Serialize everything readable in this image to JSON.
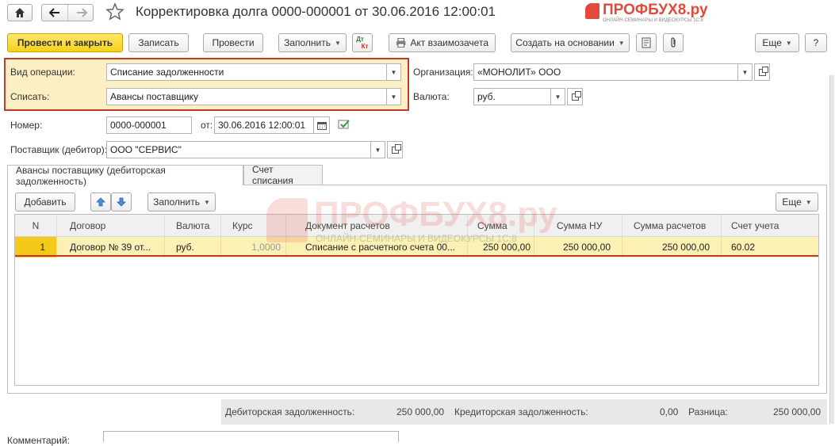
{
  "window": {
    "title": "Корректировка долга 0000-000001 от 30.06.2016 12:00:01",
    "watermark_brand": "ПРОФБУХ8.ру",
    "watermark_sub": "ОНЛАЙН-СЕМИНАРЫ И ВИДЕОКУРСЫ 1С:8"
  },
  "toolbar": {
    "post_close": "Провести и закрыть",
    "save": "Записать",
    "post": "Провести",
    "fill": "Заполнить",
    "dtkt_top": "Дт",
    "dtkt_bottom": "Кт",
    "act": "Акт взаимозачета",
    "create_based": "Создать на основании",
    "more": "Еще",
    "help": "?"
  },
  "form": {
    "operation_label": "Вид операции:",
    "operation_value": "Списание задолженности",
    "writeoff_label": "Списать:",
    "writeoff_value": "Авансы поставщику",
    "org_label": "Организация:",
    "org_value": "«МОНОЛИТ» ООО",
    "currency_label": "Валюта:",
    "currency_value": "руб.",
    "number_label": "Номер:",
    "number_value": "0000-000001",
    "date_label": "от:",
    "date_value": "30.06.2016 12:00:01",
    "supplier_label": "Поставщик (дебитор):",
    "supplier_value": "ООО \"СЕРВИС\""
  },
  "tabs": [
    {
      "label": "Авансы поставщику (дебиторская задолженность)"
    },
    {
      "label": "Счет списания"
    }
  ],
  "table_toolbar": {
    "add": "Добавить",
    "fill": "Заполнить",
    "more": "Еще"
  },
  "table": {
    "headers": [
      "N",
      "Договор",
      "Валюта",
      "Курс",
      "Документ расчетов",
      "Сумма",
      "Сумма НУ",
      "Сумма расчетов",
      "Счет учета"
    ],
    "rows": [
      [
        "1",
        "Договор № 39 от...",
        "руб.",
        "1,0000",
        "Списание с расчетного счета 00...",
        "250 000,00",
        "250 000,00",
        "250 000,00",
        "60.02"
      ]
    ]
  },
  "footer": {
    "debit_label": "Дебиторская задолженность:",
    "debit_value": "250 000,00",
    "credit_label": "Кредиторская задолженность:",
    "credit_value": "0,00",
    "diff_label": "Разница:",
    "diff_value": "250 000,00",
    "comment_label": "Комментарий:"
  },
  "colors": {
    "accent_yellow": "#f6d21b",
    "highlight_box": "#c0392b",
    "selected_row": "#fbf1b5",
    "brand_red": "#e24a3b"
  }
}
